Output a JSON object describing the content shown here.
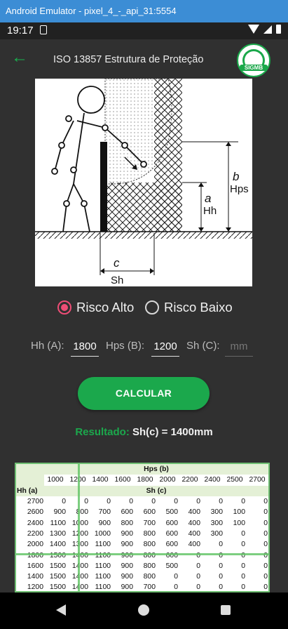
{
  "emulator": {
    "title": "Android Emulator - pixel_4_-_api_31:5554"
  },
  "status": {
    "time": "19:17"
  },
  "appbar": {
    "back_icon": "arrow-left-icon",
    "title": "ISO 13857 Estrutura de Proteção",
    "logo_text": "SIGMB"
  },
  "figure": {
    "label_a": "a",
    "label_hh": "Hh",
    "label_b": "b",
    "label_hps": "Hps",
    "label_c": "c",
    "label_sh": "Sh"
  },
  "risk": {
    "options": [
      {
        "label": "Risco Alto",
        "selected": true
      },
      {
        "label": "Risco Baixo",
        "selected": false
      }
    ]
  },
  "inputs": {
    "hh_label": "Hh (A):",
    "hh_value": "1800",
    "hps_label": "Hps (B):",
    "hps_value": "1200",
    "sh_label": "Sh (C):",
    "sh_placeholder": "mm"
  },
  "button": {
    "label": "CALCULAR"
  },
  "result": {
    "key": "Resultado:",
    "value": "Sh(c) = 1400mm"
  },
  "table": {
    "hps_title": "Hps (b)",
    "hh_title": "Hh (a)",
    "sh_title": "Sh (c)",
    "columns": [
      "1000",
      "1200",
      "1400",
      "1600",
      "1800",
      "2000",
      "2200",
      "2400",
      "2500",
      "2700"
    ],
    "rows": [
      [
        "2700",
        "0",
        "0",
        "0",
        "0",
        "0",
        "0",
        "0",
        "0",
        "0",
        "0"
      ],
      [
        "2600",
        "900",
        "800",
        "700",
        "600",
        "600",
        "500",
        "400",
        "300",
        "100",
        "0"
      ],
      [
        "2400",
        "1100",
        "1000",
        "900",
        "800",
        "700",
        "600",
        "400",
        "300",
        "100",
        "0"
      ],
      [
        "2200",
        "1300",
        "1200",
        "1000",
        "900",
        "800",
        "600",
        "400",
        "300",
        "0",
        "0"
      ],
      [
        "2000",
        "1400",
        "1300",
        "1100",
        "900",
        "800",
        "600",
        "400",
        "0",
        "0",
        "0"
      ],
      [
        "1800",
        "1500",
        "1400",
        "1100",
        "900",
        "800",
        "600",
        "0",
        "0",
        "0",
        "0"
      ],
      [
        "1600",
        "1500",
        "1400",
        "1100",
        "900",
        "800",
        "500",
        "0",
        "0",
        "0",
        "0"
      ],
      [
        "1400",
        "1500",
        "1400",
        "1100",
        "900",
        "800",
        "0",
        "0",
        "0",
        "0",
        "0"
      ],
      [
        "1200",
        "1500",
        "1400",
        "1100",
        "900",
        "700",
        "0",
        "0",
        "0",
        "0",
        "0"
      ]
    ]
  },
  "colors": {
    "accent": "#1ba84c",
    "radio": "#ee4d76",
    "background": "#303030"
  }
}
